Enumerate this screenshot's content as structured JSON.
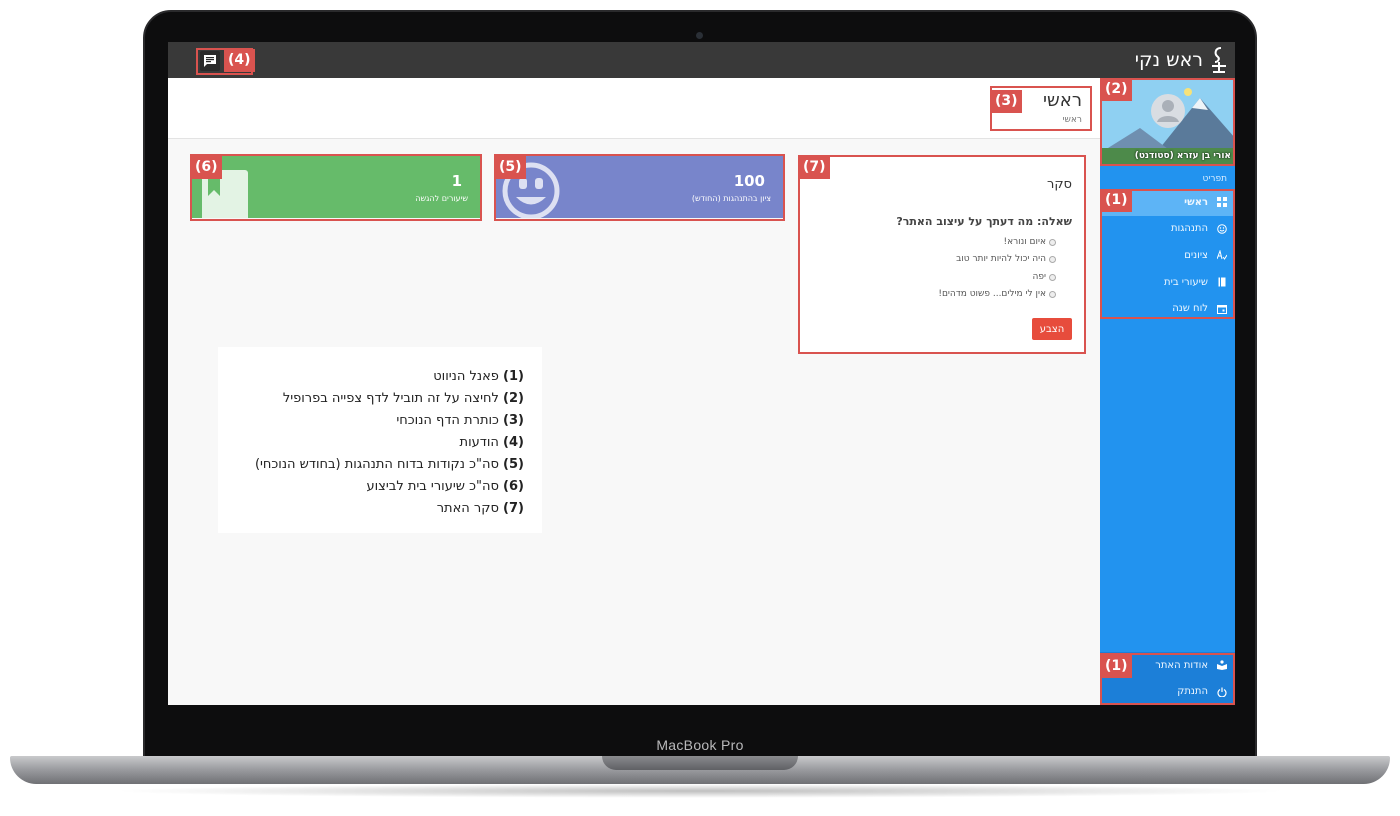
{
  "device": {
    "label": "MacBook Pro"
  },
  "app": {
    "title": "ראש נקי"
  },
  "header": {
    "title": "ראשי",
    "breadcrumb": "ראשי"
  },
  "profile": {
    "name": "אורי בן עזרא (סטודנט)"
  },
  "sidebar": {
    "section_label": "תפריט",
    "items": [
      {
        "label": "ראשי",
        "icon": "dashboard-icon",
        "active": true
      },
      {
        "label": "התנהגות",
        "icon": "smiley-icon"
      },
      {
        "label": "ציונים",
        "icon": "grade-icon"
      },
      {
        "label": "שיעורי בית",
        "icon": "book-icon"
      },
      {
        "label": "לוח שנה",
        "icon": "calendar-icon"
      }
    ],
    "bottom_items": [
      {
        "label": "אודות האתר",
        "icon": "reader-icon"
      },
      {
        "label": "התנתק",
        "icon": "power-icon"
      }
    ]
  },
  "survey": {
    "title": "סקר",
    "question": "שאלה: מה דעתך על עיצוב האתר?",
    "options": [
      "איום ונורא!",
      "היה יכול להיות יותר טוב",
      "יפה",
      "אין לי מילים... פשוט מדהים!"
    ],
    "submit_label": "הצבע"
  },
  "cards": {
    "behavior": {
      "value": "100",
      "label": "ציון בהתנהגות (החודש)"
    },
    "homework": {
      "value": "1",
      "label": "שיעורים להגשה"
    }
  },
  "callouts": [
    "(1)",
    "(2)",
    "(3)",
    "(4)",
    "(5)",
    "(6)",
    "(7)"
  ],
  "legend": [
    {
      "num": "(1)",
      "text": "פאנל הניווט"
    },
    {
      "num": "(2)",
      "text": "לחיצה על זה תוביל לדף צפייה בפרופיל"
    },
    {
      "num": "(3)",
      "text": "כותרת הדף הנוכחי"
    },
    {
      "num": "(4)",
      "text": "הודעות"
    },
    {
      "num": "(5)",
      "text": "סה\"כ נקודות בדוח התנהגות (בחודש הנוכחי)"
    },
    {
      "num": "(6)",
      "text": "סה\"כ שיעורי בית לביצוע"
    },
    {
      "num": "(7)",
      "text": "סקר האתר"
    }
  ],
  "colors": {
    "topbar": "#393939",
    "sidebar": "#2293ef",
    "sidebar_active": "#5db4f6",
    "card_behavior": "#7885cb",
    "card_homework": "#66bb6a",
    "callout": "#d9534f",
    "vote_button": "#e74c3c"
  }
}
